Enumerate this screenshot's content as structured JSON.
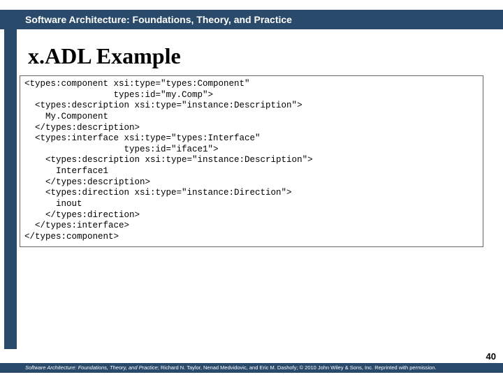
{
  "header": {
    "title": "Software Architecture: Foundations, Theory, and Practice"
  },
  "slide": {
    "heading": "x.ADL Example",
    "code": "<types:component xsi:type=\"types:Component\"\n                 types:id=\"my.Comp\">\n  <types:description xsi:type=\"instance:Description\">\n    My.Component\n  </types:description>\n  <types:interface xsi:type=\"types:Interface\"\n                   types:id=\"iface1\">\n    <types:description xsi:type=\"instance:Description\">\n      Interface1\n    </types:description>\n    <types:direction xsi:type=\"instance:Direction\">\n      inout\n    </types:direction>\n  </types:interface>\n</types:component>",
    "page_number": "40"
  },
  "footer": {
    "book_title": "Software Architecture: Foundations, Theory, and Practice",
    "attribution": "; Richard N. Taylor, Nenad Medvidovic, and Eric M. Dashofy; © 2010 John Wiley & Sons, Inc. Reprinted with permission."
  },
  "colors": {
    "brand": "#2a4a6b"
  }
}
